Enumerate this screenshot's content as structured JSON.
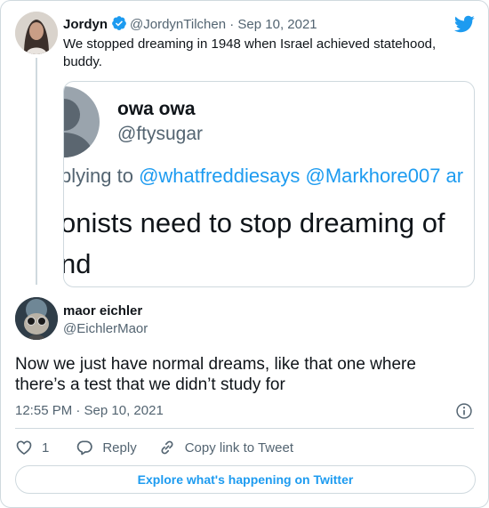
{
  "parent_tweet": {
    "name": "Jordyn",
    "handle": "@JordynTilchen",
    "separator": "·",
    "date": "Sep 10, 2021",
    "text": "We stopped dreaming in 1948 when Israel achieved statehood, buddy."
  },
  "quoted_image": {
    "name": "owa owa",
    "handle": "@ftysugar",
    "replying_prefix": "plying to ",
    "replying_links": "@whatfreddiesays @Markhore007 ar",
    "text_line1": "onists need to stop dreaming of",
    "text_line2": "nd"
  },
  "main_tweet": {
    "name": "maor eichler",
    "handle": "@EichlerMaor",
    "text": "Now we just have normal dreams, like that one where there’s a test that we didn’t study for",
    "timestamp": "12:55 PM · Sep 10, 2021"
  },
  "actions": {
    "like_count": "1",
    "reply_label": "Reply",
    "copy_label": "Copy link to Tweet"
  },
  "explore_label": "Explore what's happening on Twitter",
  "colors": {
    "accent": "#1d9bf0",
    "text": "#0f1419",
    "muted": "#536471",
    "border": "#cfd9de"
  },
  "icons": [
    "verified-badge-icon",
    "twitter-bird-icon",
    "info-icon",
    "heart-icon",
    "reply-icon",
    "link-icon"
  ]
}
